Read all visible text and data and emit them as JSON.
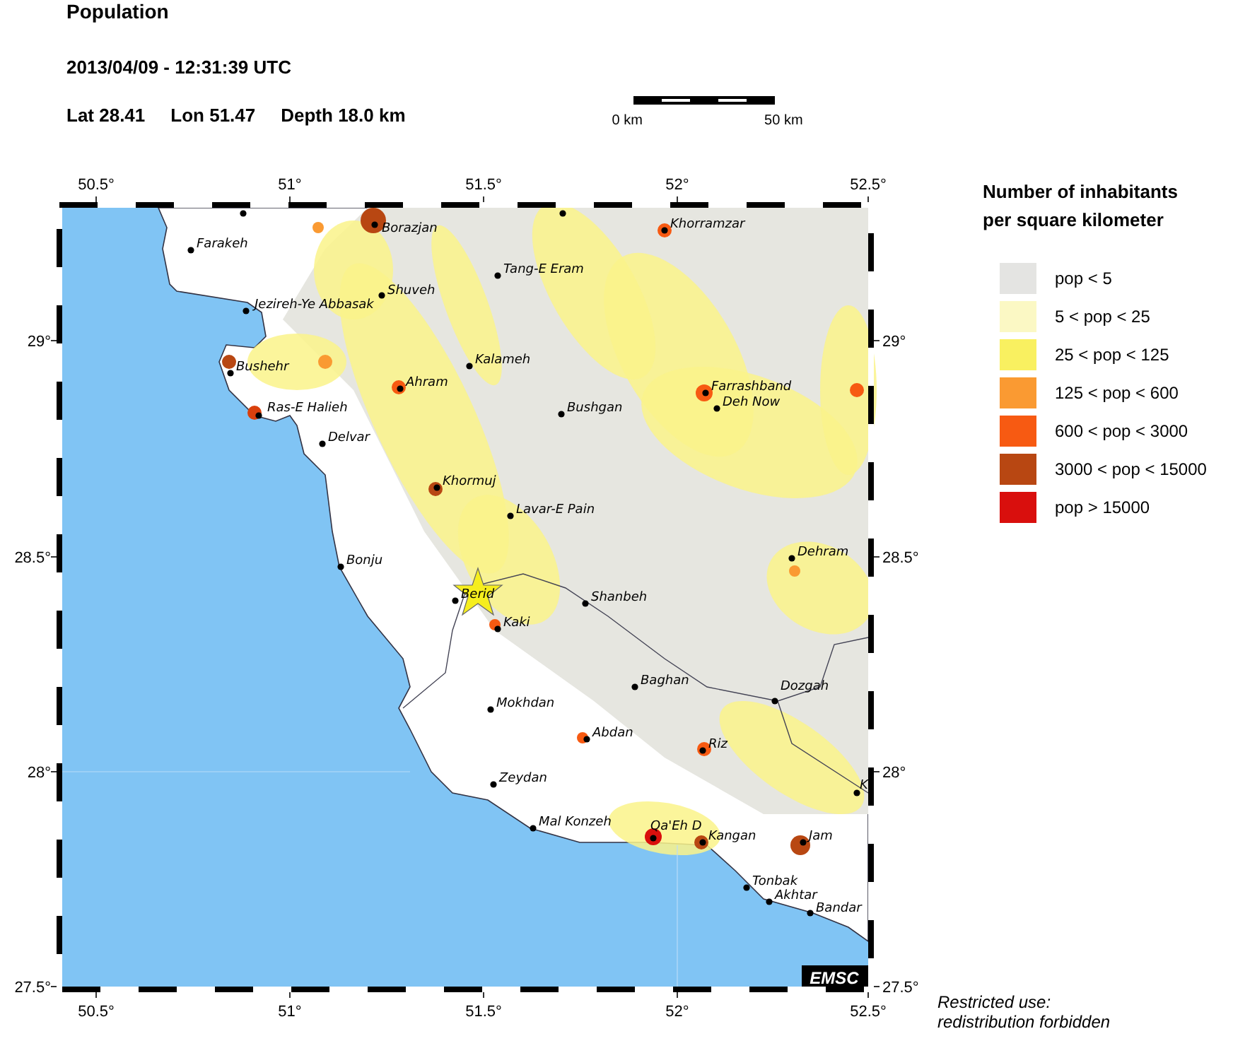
{
  "header": {
    "title": "Population",
    "datetime": "2013/04/09 - 12:31:39 UTC",
    "lat": "Lat 28.41",
    "lon": "Lon  51.47",
    "depth": "Depth  18.0 km"
  },
  "scale_bar": {
    "start_label": "0 km",
    "end_label": "50 km"
  },
  "map": {
    "x_ticks_top": [
      "50.5°",
      "51°",
      "51.5°",
      "52°",
      "52.5°"
    ],
    "x_ticks_bottom": [
      "50.5°",
      "51°",
      "51.5°",
      "52°",
      "52.5°"
    ],
    "y_ticks_left": [
      "29°",
      "28.5°",
      "28°",
      "27.5°"
    ],
    "y_ticks_right": [
      "29°",
      "28.5°",
      "28°",
      "27.5°"
    ],
    "cities": [
      {
        "name": "Farakeh"
      },
      {
        "name": "Borazjan"
      },
      {
        "name": "Shuveh"
      },
      {
        "name": "Jezireh-Ye Abbasak"
      },
      {
        "name": "Bushehr"
      },
      {
        "name": "Ras-E Halieh"
      },
      {
        "name": "Delvar"
      },
      {
        "name": "Ahram"
      },
      {
        "name": "Khormuj"
      },
      {
        "name": "Tang-E Eram"
      },
      {
        "name": "Kalameh"
      },
      {
        "name": "Bushgan"
      },
      {
        "name": "Khorramzar"
      },
      {
        "name": "Farrashband"
      },
      {
        "name": "Deh Now"
      },
      {
        "name": "Lavar-E Pain"
      },
      {
        "name": "Bonju"
      },
      {
        "name": "Berid"
      },
      {
        "name": "Kaki"
      },
      {
        "name": "Shanbeh"
      },
      {
        "name": "Dehram"
      },
      {
        "name": "Baghan"
      },
      {
        "name": "Dozgah"
      },
      {
        "name": "Mokhdan"
      },
      {
        "name": "Abdan"
      },
      {
        "name": "Riz"
      },
      {
        "name": "Zeydan"
      },
      {
        "name": "Mal Konzeh"
      },
      {
        "name": "Qa'Eh D"
      },
      {
        "name": "Kangan"
      },
      {
        "name": "Jam"
      },
      {
        "name": "Tonbak"
      },
      {
        "name": "Akhtar"
      },
      {
        "name": "Bandar"
      },
      {
        "name": "K"
      }
    ],
    "logo": "EMSC"
  },
  "legend": {
    "title_lines": [
      "Number of inhabitants",
      "per square kilometer"
    ],
    "items": [
      {
        "label": "pop < 5",
        "color": "#e4e4e2"
      },
      {
        "label": "5 < pop < 25",
        "color": "#fbf8c4"
      },
      {
        "label": "25 < pop < 125",
        "color": "#f9f060"
      },
      {
        "label": "125 < pop < 600",
        "color": "#fa9a32"
      },
      {
        "label": "600 < pop < 3000",
        "color": "#f75a12"
      },
      {
        "label": "3000 < pop < 15000",
        "color": "#b84712"
      },
      {
        "label": "pop > 15000",
        "color": "#d90f0d"
      }
    ]
  },
  "notice_lines": [
    "Restricted use:",
    "redistribution forbidden"
  ]
}
